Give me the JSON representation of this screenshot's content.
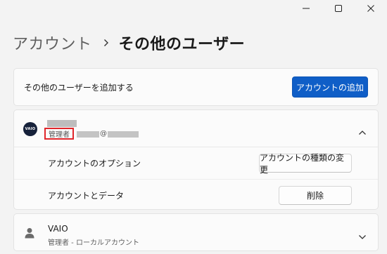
{
  "window": {
    "minimize_icon": "minimize-icon",
    "maximize_icon": "maximize-icon",
    "close_icon": "close-icon"
  },
  "breadcrumb": {
    "parent": "アカウント",
    "separator_icon": "chevron-right-icon",
    "current": "その他のユーザー"
  },
  "add_user": {
    "label": "その他のユーザーを追加する",
    "button": "アカウントの追加"
  },
  "user_account": {
    "avatar_text": "VAIO",
    "role": "管理者",
    "email_at": "@",
    "expand_icon": "chevron-up-icon",
    "options_label": "アカウントのオプション",
    "change_type_button": "アカウントの種類の変更",
    "data_label": "アカウントとデータ",
    "delete_button": "削除"
  },
  "other_account": {
    "icon": "person-icon",
    "name": "VAIO",
    "subtitle": "管理者 - ローカルアカウント",
    "expand_icon": "chevron-down-icon"
  },
  "colors": {
    "accent": "#0f5ec7",
    "highlight_border": "#e0262b"
  }
}
